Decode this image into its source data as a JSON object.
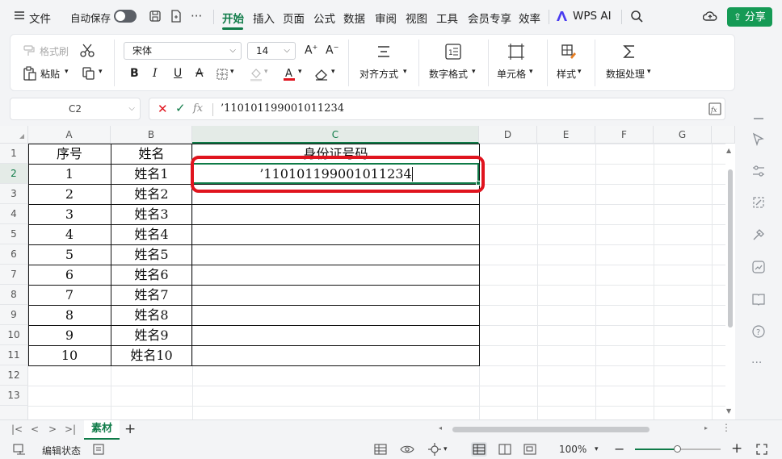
{
  "menubar": {
    "file": "文件",
    "autosave": "自动保存",
    "tabs": [
      "开始",
      "插入",
      "页面",
      "公式",
      "数据",
      "审阅",
      "视图",
      "工具",
      "会员专享",
      "效率"
    ],
    "ai": "WPS AI",
    "share": "分享"
  },
  "ribbon": {
    "format_painter": "格式刷",
    "paste": "粘贴",
    "font": "宋体",
    "font_size": "14",
    "align": "对齐方式",
    "number_format": "数字格式",
    "cell": "单元格",
    "style": "样式",
    "data_process": "数据处理"
  },
  "formula_bar": {
    "name_box": "C2",
    "fx": "fx",
    "value": "’110101199001011234"
  },
  "columns": [
    "A",
    "B",
    "C",
    "D",
    "E",
    "F",
    "G"
  ],
  "rows": [
    "1",
    "2",
    "3",
    "4",
    "5",
    "6",
    "7",
    "8",
    "9",
    "10",
    "11",
    "12",
    "13"
  ],
  "table": {
    "header": [
      "序号",
      "姓名",
      "身份证号码"
    ],
    "rows": [
      [
        "1",
        "姓名1",
        "’110101199001011234"
      ],
      [
        "2",
        "姓名2",
        ""
      ],
      [
        "3",
        "姓名3",
        ""
      ],
      [
        "4",
        "姓名4",
        ""
      ],
      [
        "5",
        "姓名5",
        ""
      ],
      [
        "6",
        "姓名6",
        ""
      ],
      [
        "7",
        "姓名7",
        ""
      ],
      [
        "8",
        "姓名8",
        ""
      ],
      [
        "9",
        "姓名9",
        ""
      ],
      [
        "10",
        "姓名10",
        ""
      ]
    ]
  },
  "sheet_tab": "素材",
  "status": {
    "mode": "编辑状态",
    "zoom": "100%",
    "zoom_fraction": 0.5
  },
  "colors": {
    "accent": "#0f7b48",
    "highlight": "#e0141e",
    "share": "#159a55"
  }
}
